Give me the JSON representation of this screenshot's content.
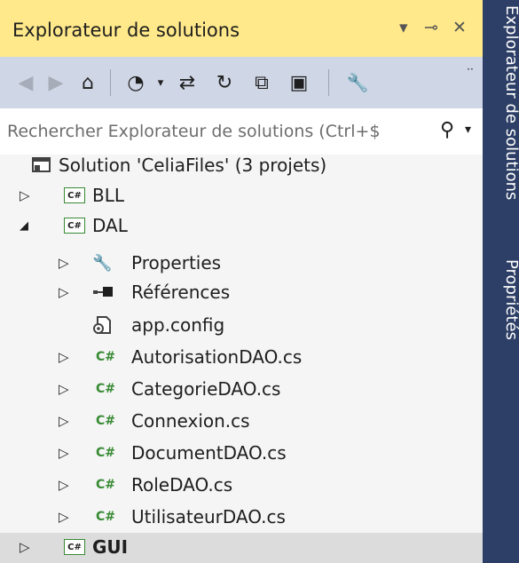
{
  "panel": {
    "title": "Explorateur de solutions",
    "controls": {
      "dropdown": "▾",
      "pin": "⊸",
      "close": "✕"
    }
  },
  "toolbar": {
    "overflow": "··",
    "buttons": [
      {
        "name": "back-button",
        "icon": "back-icon",
        "glyph": "◀"
      },
      {
        "name": "forward-button",
        "icon": "forward-icon",
        "glyph": "▶"
      },
      {
        "name": "home-button",
        "icon": "home-icon",
        "glyph": "⌂"
      },
      {
        "name": "pending-changes-filter-button",
        "icon": "clock-icon",
        "glyph": "◔"
      },
      {
        "name": "sync-button",
        "icon": "sync-icon",
        "glyph": "⇄"
      },
      {
        "name": "refresh-button",
        "icon": "refresh-icon",
        "glyph": "↻"
      },
      {
        "name": "collapse-all-button",
        "icon": "collapse-all-icon",
        "glyph": "⧉"
      },
      {
        "name": "show-all-files-button",
        "icon": "show-all-files-icon",
        "glyph": "▣"
      },
      {
        "name": "properties-button",
        "icon": "wrench-icon",
        "glyph": "🔧"
      }
    ]
  },
  "search": {
    "placeholder": "Rechercher Explorateur de solutions (Ctrl+$"
  },
  "tree": {
    "items": [
      {
        "label": "Solution 'CeliaFiles' (3 projets)",
        "icon": "solution-icon",
        "indent": 0,
        "expander": ""
      },
      {
        "label": "BLL",
        "icon": "csharp-project-icon",
        "indent": 0,
        "expander": "▷",
        "badge": "C#"
      },
      {
        "label": "DAL",
        "icon": "csharp-project-icon",
        "indent": 0,
        "expander": "◢",
        "badge": "C#"
      },
      {
        "label": "Properties",
        "icon": "wrench-icon",
        "indent": 1,
        "expander": "▷"
      },
      {
        "label": "Références",
        "icon": "references-icon",
        "indent": 1,
        "expander": "▷"
      },
      {
        "label": "app.config",
        "icon": "config-file-icon",
        "indent": 1,
        "expander": ""
      },
      {
        "label": "AutorisationDAO.cs",
        "icon": "csharp-file-icon",
        "indent": 1,
        "expander": "▷",
        "badge": "C#"
      },
      {
        "label": "CategorieDAO.cs",
        "icon": "csharp-file-icon",
        "indent": 1,
        "expander": "▷",
        "badge": "C#"
      },
      {
        "label": "Connexion.cs",
        "icon": "csharp-file-icon",
        "indent": 1,
        "expander": "▷",
        "badge": "C#"
      },
      {
        "label": "DocumentDAO.cs",
        "icon": "csharp-file-icon",
        "indent": 1,
        "expander": "▷",
        "badge": "C#"
      },
      {
        "label": "RoleDAO.cs",
        "icon": "csharp-file-icon",
        "indent": 1,
        "expander": "▷",
        "badge": "C#"
      },
      {
        "label": "UtilisateurDAO.cs",
        "icon": "csharp-file-icon",
        "indent": 1,
        "expander": "▷",
        "badge": "C#"
      },
      {
        "label": "GUI",
        "icon": "csharp-project-icon",
        "indent": 0,
        "expander": "▷",
        "badge": "C#",
        "selected": true
      }
    ]
  },
  "sidebar": {
    "tabs": [
      "Explorateur de solutions",
      "Propriétés"
    ]
  },
  "colors": {
    "title_bar": "#ffe98a",
    "toolbar": "#cfd6e5",
    "sidebar": "#2d3f66",
    "csharp_green": "#388a34",
    "selection": "#dcdcdc"
  }
}
